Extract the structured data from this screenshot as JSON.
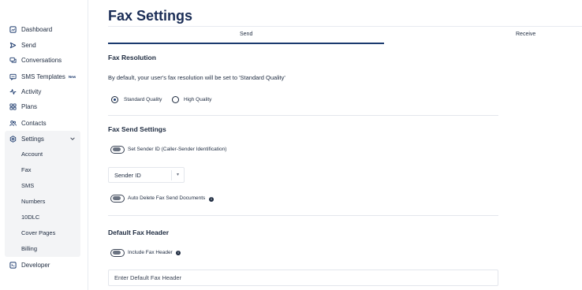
{
  "sidebar": {
    "items": [
      {
        "label": "Dashboard",
        "icon": "dashboard-icon"
      },
      {
        "label": "Send",
        "icon": "send-icon"
      },
      {
        "label": "Conversations",
        "icon": "conversations-icon"
      },
      {
        "label": "SMS Templates",
        "icon": "sms-templates-icon",
        "badge": "New"
      },
      {
        "label": "Activity",
        "icon": "activity-icon"
      },
      {
        "label": "Plans",
        "icon": "plans-icon"
      },
      {
        "label": "Contacts",
        "icon": "contacts-icon"
      }
    ],
    "settings": {
      "label": "Settings",
      "icon": "gear-icon",
      "expanded": true,
      "sub_items": [
        "Account",
        "Fax",
        "SMS",
        "Numbers",
        "10DLC",
        "Cover Pages",
        "Billing"
      ]
    },
    "developer": {
      "label": "Developer",
      "icon": "developer-icon"
    }
  },
  "page": {
    "title": "Fax Settings",
    "tabs": [
      {
        "label": "Send",
        "active": true
      },
      {
        "label": "Receive",
        "active": false
      }
    ],
    "accent_color": "#1a3a6e"
  },
  "fax_resolution": {
    "title": "Fax Resolution",
    "description": "By default, your user's fax resolution will be set to 'Standard Quality'",
    "options": [
      {
        "label": "Standard Quality",
        "selected": true
      },
      {
        "label": "High Quality",
        "selected": false
      }
    ]
  },
  "fax_send_settings": {
    "title": "Fax Send Settings",
    "sender_id_toggle": {
      "label": "Set Sender ID (Caller-Sender Identification)",
      "on": false
    },
    "sender_id_select": {
      "value": "Sender ID",
      "caret": "▾"
    },
    "auto_delete_toggle": {
      "label": "Auto Delete Fax Send Documents",
      "on": false,
      "info": "i"
    }
  },
  "default_fax_header": {
    "title": "Default Fax Header",
    "include_toggle": {
      "label": "Include Fax Header",
      "on": false,
      "info": "i"
    },
    "input": {
      "placeholder": "Enter Default Fax Header",
      "value": ""
    }
  }
}
